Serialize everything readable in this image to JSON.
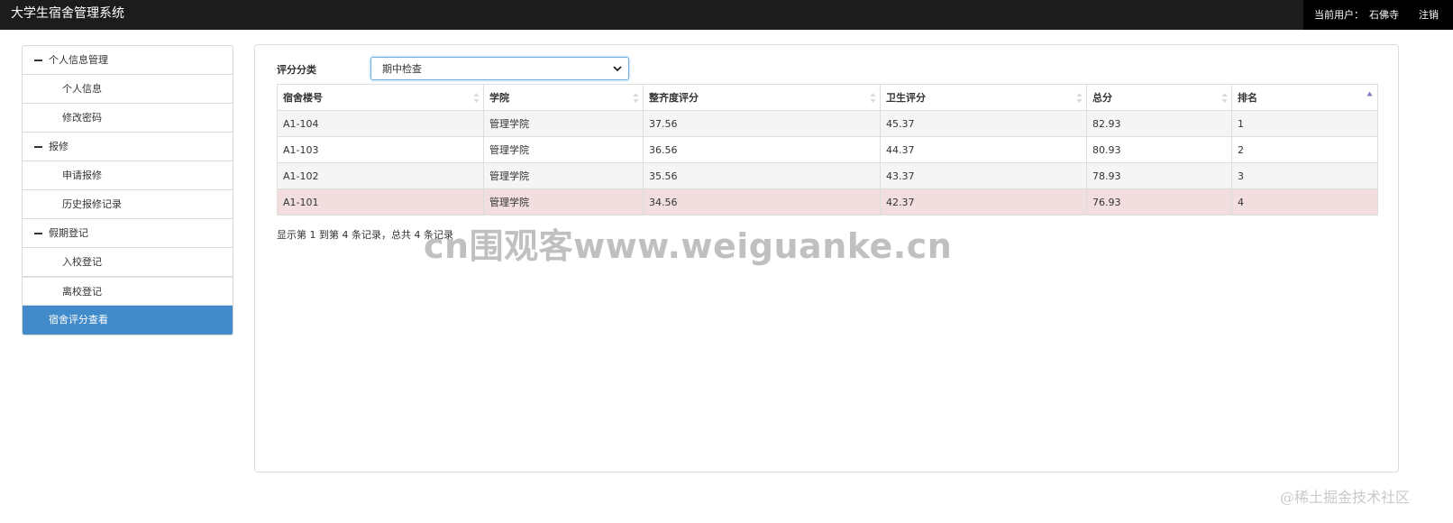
{
  "header": {
    "title": "大学生宿舍管理系统",
    "user_label": "当前用户：",
    "user_name": "石佛寺",
    "logout_label": "注销"
  },
  "sidebar": {
    "groups": [
      {
        "label": "个人信息管理",
        "items": [
          {
            "label": "个人信息"
          },
          {
            "label": "修改密码"
          }
        ]
      },
      {
        "label": "报修",
        "items": [
          {
            "label": "申请报修"
          },
          {
            "label": "历史报修记录"
          }
        ]
      },
      {
        "label": "假期登记",
        "items": [
          {
            "label": "入校登记"
          },
          {
            "label": "离校登记"
          }
        ]
      }
    ],
    "active_item": {
      "label": "宿舍评分查看"
    }
  },
  "filter": {
    "label": "评分分类",
    "selected": "期中检查"
  },
  "table": {
    "columns": [
      {
        "label": "宿舍楼号"
      },
      {
        "label": "学院"
      },
      {
        "label": "整齐度评分"
      },
      {
        "label": "卫生评分"
      },
      {
        "label": "总分"
      },
      {
        "label": "排名"
      }
    ],
    "rows": [
      [
        "A1-104",
        "管理学院",
        "37.56",
        "45.37",
        "82.93",
        "1"
      ],
      [
        "A1-103",
        "管理学院",
        "36.56",
        "44.37",
        "80.93",
        "2"
      ],
      [
        "A1-102",
        "管理学院",
        "35.56",
        "43.37",
        "78.93",
        "3"
      ],
      [
        "A1-101",
        "管理学院",
        "34.56",
        "42.37",
        "76.93",
        "4"
      ]
    ],
    "sorted_column": "排名",
    "sort_direction": "asc",
    "highlight_row_color": "#f2dede"
  },
  "pagination": {
    "text": "显示第 1 到第 4 条记录，总共 4 条记录"
  },
  "watermarks": {
    "main": "cn围观客www.weiguanke.cn",
    "corner": "@稀土掘金技术社区"
  },
  "colors": {
    "navbar": "#1c1c1c",
    "accent": "#428bca"
  }
}
